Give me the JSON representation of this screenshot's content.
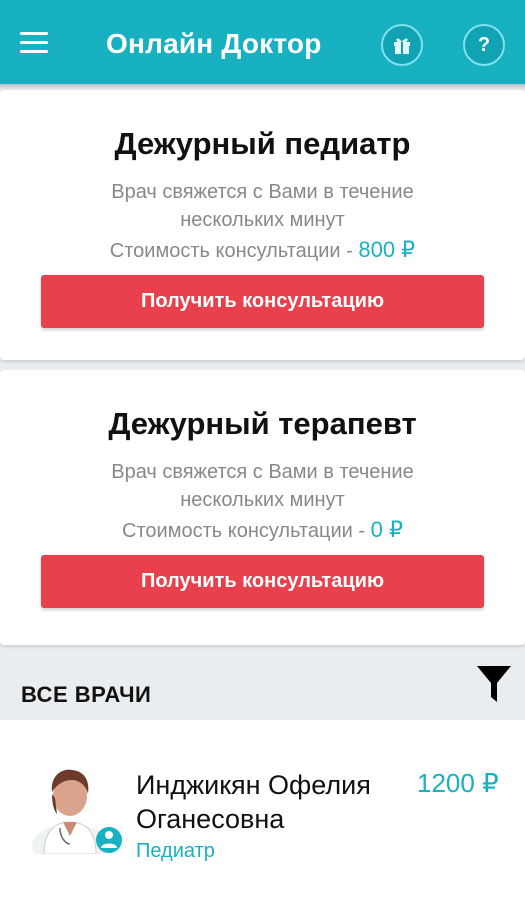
{
  "header": {
    "title": "Онлайн Доктор",
    "help_label": "?"
  },
  "cards": [
    {
      "title": "Дежурный педиатр",
      "subtitle": "Врач свяжется с Вами в течение нескольких минут",
      "price_prefix": "Стоимость консультации -",
      "price": "800 ₽",
      "button_label": "Получить консультацию"
    },
    {
      "title": "Дежурный терапевт",
      "subtitle": "Врач свяжется с Вами в течение нескольких минут",
      "price_prefix": "Стоимость консультации -",
      "price": "0 ₽",
      "button_label": "Получить консультацию"
    }
  ],
  "doctors_section": {
    "title": "ВСЕ ВРАЧИ"
  },
  "doctors": [
    {
      "name": "Инджикян Офелия Оганесовна",
      "specialty": "Педиатр",
      "price": "1200 ₽"
    }
  ],
  "colors": {
    "header": "#17b1c2",
    "accent": "#17b1c2",
    "cta": "#e8404d",
    "background": "#e9edf0"
  },
  "icons": {
    "menu": "menu-icon",
    "gift": "gift-icon",
    "help": "help-icon",
    "filter": "filter-icon",
    "doctor_badge": "doctor-badge-icon"
  }
}
